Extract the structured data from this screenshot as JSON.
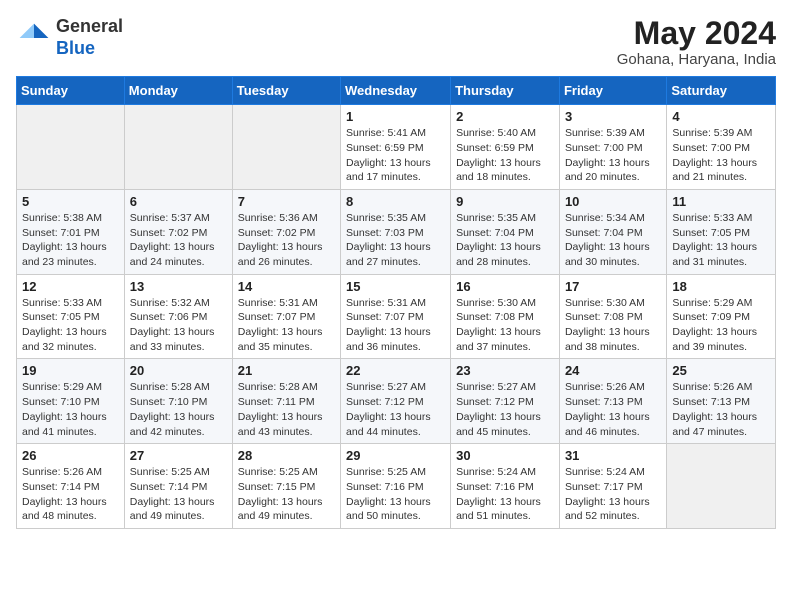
{
  "logo": {
    "general": "General",
    "blue": "Blue"
  },
  "title": {
    "month_year": "May 2024",
    "location": "Gohana, Haryana, India"
  },
  "headers": [
    "Sunday",
    "Monday",
    "Tuesday",
    "Wednesday",
    "Thursday",
    "Friday",
    "Saturday"
  ],
  "weeks": [
    [
      {
        "day": "",
        "sunrise": "",
        "sunset": "",
        "daylight": ""
      },
      {
        "day": "",
        "sunrise": "",
        "sunset": "",
        "daylight": ""
      },
      {
        "day": "",
        "sunrise": "",
        "sunset": "",
        "daylight": ""
      },
      {
        "day": "1",
        "sunrise": "Sunrise: 5:41 AM",
        "sunset": "Sunset: 6:59 PM",
        "daylight": "Daylight: 13 hours and 17 minutes."
      },
      {
        "day": "2",
        "sunrise": "Sunrise: 5:40 AM",
        "sunset": "Sunset: 6:59 PM",
        "daylight": "Daylight: 13 hours and 18 minutes."
      },
      {
        "day": "3",
        "sunrise": "Sunrise: 5:39 AM",
        "sunset": "Sunset: 7:00 PM",
        "daylight": "Daylight: 13 hours and 20 minutes."
      },
      {
        "day": "4",
        "sunrise": "Sunrise: 5:39 AM",
        "sunset": "Sunset: 7:00 PM",
        "daylight": "Daylight: 13 hours and 21 minutes."
      }
    ],
    [
      {
        "day": "5",
        "sunrise": "Sunrise: 5:38 AM",
        "sunset": "Sunset: 7:01 PM",
        "daylight": "Daylight: 13 hours and 23 minutes."
      },
      {
        "day": "6",
        "sunrise": "Sunrise: 5:37 AM",
        "sunset": "Sunset: 7:02 PM",
        "daylight": "Daylight: 13 hours and 24 minutes."
      },
      {
        "day": "7",
        "sunrise": "Sunrise: 5:36 AM",
        "sunset": "Sunset: 7:02 PM",
        "daylight": "Daylight: 13 hours and 26 minutes."
      },
      {
        "day": "8",
        "sunrise": "Sunrise: 5:35 AM",
        "sunset": "Sunset: 7:03 PM",
        "daylight": "Daylight: 13 hours and 27 minutes."
      },
      {
        "day": "9",
        "sunrise": "Sunrise: 5:35 AM",
        "sunset": "Sunset: 7:04 PM",
        "daylight": "Daylight: 13 hours and 28 minutes."
      },
      {
        "day": "10",
        "sunrise": "Sunrise: 5:34 AM",
        "sunset": "Sunset: 7:04 PM",
        "daylight": "Daylight: 13 hours and 30 minutes."
      },
      {
        "day": "11",
        "sunrise": "Sunrise: 5:33 AM",
        "sunset": "Sunset: 7:05 PM",
        "daylight": "Daylight: 13 hours and 31 minutes."
      }
    ],
    [
      {
        "day": "12",
        "sunrise": "Sunrise: 5:33 AM",
        "sunset": "Sunset: 7:05 PM",
        "daylight": "Daylight: 13 hours and 32 minutes."
      },
      {
        "day": "13",
        "sunrise": "Sunrise: 5:32 AM",
        "sunset": "Sunset: 7:06 PM",
        "daylight": "Daylight: 13 hours and 33 minutes."
      },
      {
        "day": "14",
        "sunrise": "Sunrise: 5:31 AM",
        "sunset": "Sunset: 7:07 PM",
        "daylight": "Daylight: 13 hours and 35 minutes."
      },
      {
        "day": "15",
        "sunrise": "Sunrise: 5:31 AM",
        "sunset": "Sunset: 7:07 PM",
        "daylight": "Daylight: 13 hours and 36 minutes."
      },
      {
        "day": "16",
        "sunrise": "Sunrise: 5:30 AM",
        "sunset": "Sunset: 7:08 PM",
        "daylight": "Daylight: 13 hours and 37 minutes."
      },
      {
        "day": "17",
        "sunrise": "Sunrise: 5:30 AM",
        "sunset": "Sunset: 7:08 PM",
        "daylight": "Daylight: 13 hours and 38 minutes."
      },
      {
        "day": "18",
        "sunrise": "Sunrise: 5:29 AM",
        "sunset": "Sunset: 7:09 PM",
        "daylight": "Daylight: 13 hours and 39 minutes."
      }
    ],
    [
      {
        "day": "19",
        "sunrise": "Sunrise: 5:29 AM",
        "sunset": "Sunset: 7:10 PM",
        "daylight": "Daylight: 13 hours and 41 minutes."
      },
      {
        "day": "20",
        "sunrise": "Sunrise: 5:28 AM",
        "sunset": "Sunset: 7:10 PM",
        "daylight": "Daylight: 13 hours and 42 minutes."
      },
      {
        "day": "21",
        "sunrise": "Sunrise: 5:28 AM",
        "sunset": "Sunset: 7:11 PM",
        "daylight": "Daylight: 13 hours and 43 minutes."
      },
      {
        "day": "22",
        "sunrise": "Sunrise: 5:27 AM",
        "sunset": "Sunset: 7:12 PM",
        "daylight": "Daylight: 13 hours and 44 minutes."
      },
      {
        "day": "23",
        "sunrise": "Sunrise: 5:27 AM",
        "sunset": "Sunset: 7:12 PM",
        "daylight": "Daylight: 13 hours and 45 minutes."
      },
      {
        "day": "24",
        "sunrise": "Sunrise: 5:26 AM",
        "sunset": "Sunset: 7:13 PM",
        "daylight": "Daylight: 13 hours and 46 minutes."
      },
      {
        "day": "25",
        "sunrise": "Sunrise: 5:26 AM",
        "sunset": "Sunset: 7:13 PM",
        "daylight": "Daylight: 13 hours and 47 minutes."
      }
    ],
    [
      {
        "day": "26",
        "sunrise": "Sunrise: 5:26 AM",
        "sunset": "Sunset: 7:14 PM",
        "daylight": "Daylight: 13 hours and 48 minutes."
      },
      {
        "day": "27",
        "sunrise": "Sunrise: 5:25 AM",
        "sunset": "Sunset: 7:14 PM",
        "daylight": "Daylight: 13 hours and 49 minutes."
      },
      {
        "day": "28",
        "sunrise": "Sunrise: 5:25 AM",
        "sunset": "Sunset: 7:15 PM",
        "daylight": "Daylight: 13 hours and 49 minutes."
      },
      {
        "day": "29",
        "sunrise": "Sunrise: 5:25 AM",
        "sunset": "Sunset: 7:16 PM",
        "daylight": "Daylight: 13 hours and 50 minutes."
      },
      {
        "day": "30",
        "sunrise": "Sunrise: 5:24 AM",
        "sunset": "Sunset: 7:16 PM",
        "daylight": "Daylight: 13 hours and 51 minutes."
      },
      {
        "day": "31",
        "sunrise": "Sunrise: 5:24 AM",
        "sunset": "Sunset: 7:17 PM",
        "daylight": "Daylight: 13 hours and 52 minutes."
      },
      {
        "day": "",
        "sunrise": "",
        "sunset": "",
        "daylight": ""
      }
    ]
  ]
}
